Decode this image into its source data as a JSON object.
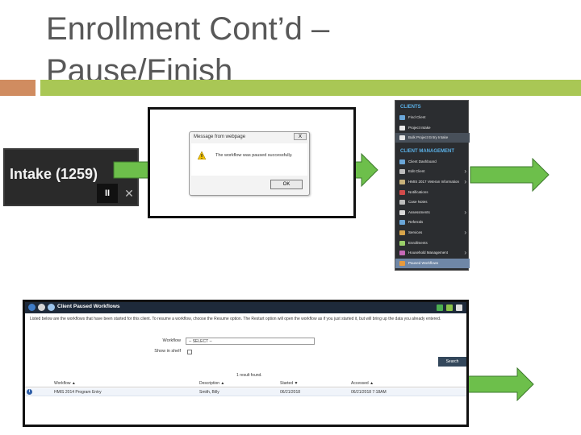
{
  "slide": {
    "title_line1": "Enrollment Cont’d –",
    "title_line2": "Pause/Finish",
    "accent_orange": "#d08c60",
    "accent_green": "#a9c755"
  },
  "intake": {
    "label": "Intake (1259)",
    "pause_icon": "pause-icon",
    "pause_glyph": "II",
    "close_icon": "close-icon",
    "close_glyph": "✕"
  },
  "arrow_color": "#6dbf4b",
  "dialog": {
    "title": "Message from webpage",
    "close_glyph": "X",
    "message": "The workflow was paused successfully.",
    "ok_label": "OK"
  },
  "side_menu": {
    "header1": "CLIENTS",
    "items1": [
      {
        "label": "Find Client",
        "icon": "search-icon",
        "color": "#6aa6d8"
      },
      {
        "label": "Project Intake",
        "icon": "intake-icon",
        "color": "#e8e8e8"
      },
      {
        "label": "Bulk Project Entry Intake",
        "icon": "bulk-icon",
        "color": "#e8e8e8"
      }
    ],
    "header2": "CLIENT MANAGEMENT",
    "items2": [
      {
        "label": "Client Dashboard",
        "icon": "dashboard-icon",
        "color": "#6aa6d8",
        "chev": false
      },
      {
        "label": "Edit Client",
        "icon": "edit-icon",
        "color": "#bdbdbd",
        "chev": true
      },
      {
        "label": "HMIS 2017 Veteran Information",
        "icon": "veteran-icon",
        "color": "#c9b27a",
        "chev": true
      },
      {
        "label": "Notifications",
        "icon": "notification-icon",
        "color": "#d24b4b",
        "chev": false
      },
      {
        "label": "Case Notes",
        "icon": "notes-icon",
        "color": "#bdbdbd",
        "chev": false
      },
      {
        "label": "Assessments",
        "icon": "assessment-icon",
        "color": "#d9d9d9",
        "chev": true
      },
      {
        "label": "Referrals",
        "icon": "referral-icon",
        "color": "#6aa6d8",
        "chev": false
      },
      {
        "label": "Services",
        "icon": "services-icon",
        "color": "#d8a54b",
        "chev": true
      },
      {
        "label": "Enrollments",
        "icon": "enrollment-icon",
        "color": "#9ad06a",
        "chev": false
      },
      {
        "label": "Household Management",
        "icon": "household-icon",
        "color": "#c76ab8",
        "chev": true
      },
      {
        "label": "Paused Workflows",
        "icon": "workflow-icon",
        "color": "#e89a3c",
        "chev": false
      }
    ]
  },
  "workflows": {
    "title": "Client Paused Workflows",
    "description": "Listed below are the workflows that have been started for this client. To resume a workflow, choose the Resume option. The Restart option will open the workflow as if you just started it, but will bring up the data you already entered.",
    "workflow_label": "Workflow",
    "workflow_value": "-- SELECT --",
    "show_label": "Show in shelf",
    "search_label": "Search",
    "result_text": "1 result found.",
    "columns": [
      "Workflow ▲",
      "Description ▲",
      "Started ▼",
      "Accessed ▲"
    ],
    "rows": [
      [
        "HMIS 2014 Program Entry",
        "Smith, Billy",
        "06/21/2018",
        "06/21/2018 7:18AM"
      ]
    ]
  }
}
